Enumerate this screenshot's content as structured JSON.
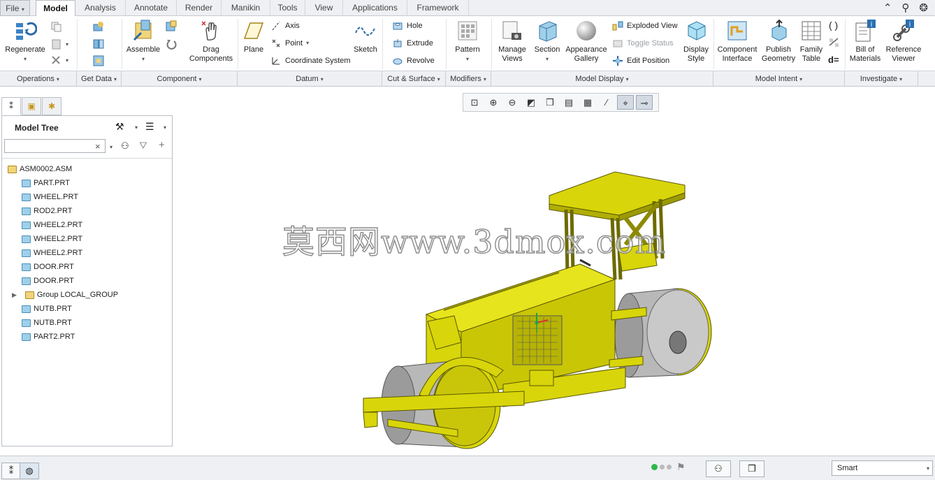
{
  "tabs": [
    {
      "label": "File",
      "arrow": "▾"
    },
    {
      "label": "Model"
    },
    {
      "label": "Analysis"
    },
    {
      "label": "Annotate"
    },
    {
      "label": "Render"
    },
    {
      "label": "Manikin"
    },
    {
      "label": "Tools"
    },
    {
      "label": "View"
    },
    {
      "label": "Applications"
    },
    {
      "label": "Framework"
    }
  ],
  "ribbon": {
    "regenerate": "Regenerate",
    "assemble": "Assemble",
    "drag_components": "Drag\nComponents",
    "plane": "Plane",
    "axis": "Axis",
    "point": "Point",
    "coordinate_system": "Coordinate System",
    "sketch": "Sketch",
    "hole": "Hole",
    "extrude": "Extrude",
    "revolve": "Revolve",
    "pattern": "Pattern",
    "manage_views": "Manage\nViews",
    "section": "Section",
    "appearance_gallery": "Appearance\nGallery",
    "exploded_view": "Exploded View",
    "toggle_status": "Toggle Status",
    "edit_position": "Edit Position",
    "display_style": "Display\nStyle",
    "component_interface": "Component\nInterface",
    "publish_geometry": "Publish\nGeometry",
    "family_table": "Family\nTable",
    "bill_of_materials": "Bill of\nMaterials",
    "reference_viewer": "Reference\nViewer",
    "d_equals": "d="
  },
  "groups": [
    {
      "label": "Operations"
    },
    {
      "label": "Get Data"
    },
    {
      "label": "Component"
    },
    {
      "label": "Datum"
    },
    {
      "label": "Cut & Surface"
    },
    {
      "label": "Modifiers"
    },
    {
      "label": "Model Display"
    },
    {
      "label": "Model Intent"
    },
    {
      "label": "Investigate"
    }
  ],
  "model_tree": {
    "title": "Model Tree",
    "search_value": "",
    "clear_glyph": "×",
    "items": [
      {
        "label": "ASM0002.ASM"
      },
      {
        "label": "PART.PRT"
      },
      {
        "label": "WHEEL.PRT"
      },
      {
        "label": "ROD2.PRT"
      },
      {
        "label": "WHEEL2.PRT"
      },
      {
        "label": "WHEEL2.PRT"
      },
      {
        "label": "WHEEL2.PRT"
      },
      {
        "label": "DOOR.PRT"
      },
      {
        "label": "DOOR.PRT"
      },
      {
        "label": "Group LOCAL_GROUP"
      },
      {
        "label": "NUTB.PRT"
      },
      {
        "label": "NUTB.PRT"
      },
      {
        "label": "PART2.PRT"
      }
    ]
  },
  "watermark": "莫西网www.3dmox.com",
  "status": {
    "filter_value": "Smart"
  },
  "colors": {
    "model_yellow": "#d8d50a",
    "roller_gray": "#b8b8b8",
    "accent_blue": "#2a6fb0"
  }
}
